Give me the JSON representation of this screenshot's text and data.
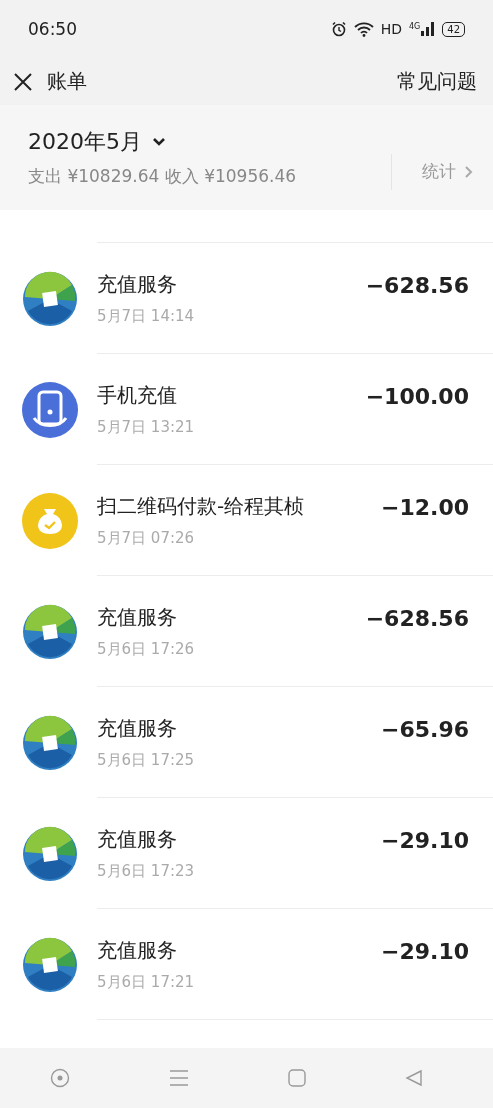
{
  "status_bar": {
    "time": "06:50",
    "hd": "HD",
    "network": "4G",
    "battery": "42"
  },
  "header": {
    "title": "账单",
    "help": "常见问题"
  },
  "summary": {
    "month": "2020年5月",
    "totals": "支出 ¥10829.64 收入 ¥10956.46",
    "stats": "统计"
  },
  "transactions": [
    {
      "kind": "bank",
      "title": "充值服务",
      "time": "5月7日 14:14",
      "amount": "−628.56"
    },
    {
      "kind": "phone",
      "title": "手机充值",
      "time": "5月7日 13:21",
      "amount": "−100.00"
    },
    {
      "kind": "money-bag",
      "title": "扫二维码付款-给程其桢",
      "time": "5月7日 07:26",
      "amount": "−12.00"
    },
    {
      "kind": "bank",
      "title": "充值服务",
      "time": "5月6日 17:26",
      "amount": "−628.56"
    },
    {
      "kind": "bank",
      "title": "充值服务",
      "time": "5月6日 17:25",
      "amount": "−65.96"
    },
    {
      "kind": "bank",
      "title": "充值服务",
      "time": "5月6日 17:23",
      "amount": "−29.10"
    },
    {
      "kind": "bank",
      "title": "充值服务",
      "time": "5月6日 17:21",
      "amount": "−29.10"
    }
  ]
}
